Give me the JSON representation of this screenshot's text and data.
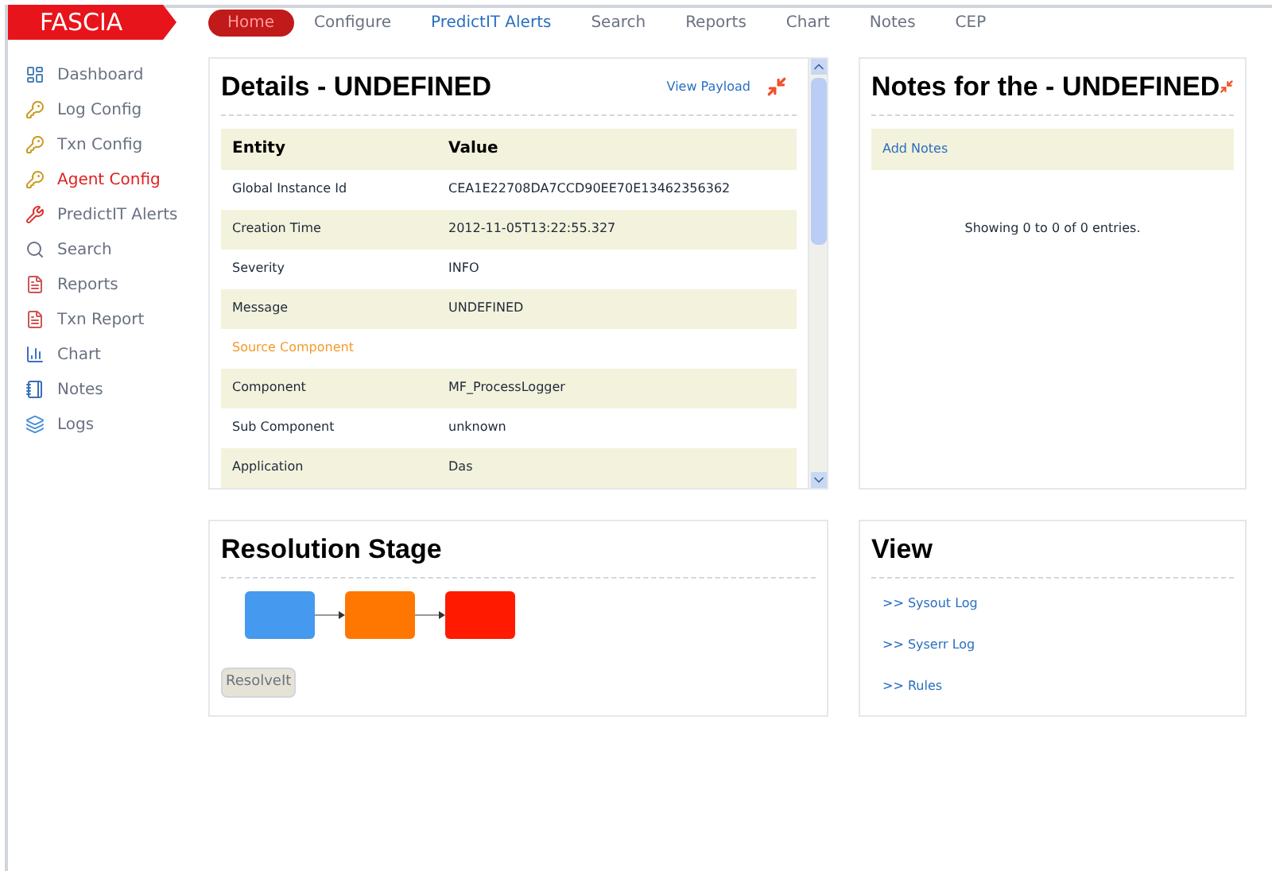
{
  "logo": "FASCIA",
  "nav": [
    {
      "label": "Home",
      "selected": true,
      "highlighted": false
    },
    {
      "label": "Configure",
      "selected": false,
      "highlighted": false
    },
    {
      "label": "PredictIT Alerts",
      "selected": false,
      "highlighted": true
    },
    {
      "label": "Search",
      "selected": false,
      "highlighted": false
    },
    {
      "label": "Reports",
      "selected": false,
      "highlighted": false
    },
    {
      "label": "Chart",
      "selected": false,
      "highlighted": false
    },
    {
      "label": "Notes",
      "selected": false,
      "highlighted": false
    },
    {
      "label": "CEP",
      "selected": false,
      "highlighted": false
    }
  ],
  "sidebar": {
    "items": [
      {
        "label": "Dashboard",
        "kind": "dashboard",
        "selected": false
      },
      {
        "label": "Log Config",
        "kind": "config",
        "selected": false
      },
      {
        "label": "Txn Config",
        "kind": "config",
        "selected": false
      },
      {
        "label": "Agent Config",
        "kind": "config",
        "selected": true
      },
      {
        "label": "PredictIT Alerts",
        "kind": "alerts",
        "selected": false
      },
      {
        "label": "Search",
        "kind": "search",
        "selected": false
      },
      {
        "label": "Reports",
        "kind": "report",
        "selected": false
      },
      {
        "label": "Txn Report",
        "kind": "report",
        "selected": false
      },
      {
        "label": "Chart",
        "kind": "chart",
        "selected": false
      },
      {
        "label": "Notes",
        "kind": "notes",
        "selected": false
      },
      {
        "label": "Logs",
        "kind": "logs",
        "selected": false
      }
    ]
  },
  "details": {
    "title": "Details - UNDEFINED",
    "link": "View Payload",
    "columns": [
      "Entity",
      "Value"
    ],
    "rows": [
      {
        "kind": "field",
        "entity": "Global Instance Id",
        "value": "CEA1E22708DA7CCD90EE70E13462356362"
      },
      {
        "kind": "field",
        "entity": "Creation Time",
        "value": "2012-11-05T13:22:55.327"
      },
      {
        "kind": "field",
        "entity": "Severity",
        "value": "INFO"
      },
      {
        "kind": "field",
        "entity": "Message",
        "value": "UNDEFINED"
      },
      {
        "kind": "section",
        "entity": "Source Component"
      },
      {
        "kind": "field",
        "entity": "Component",
        "value": "MF_ProcessLogger"
      },
      {
        "kind": "field",
        "entity": "Sub Component",
        "value": "unknown"
      },
      {
        "kind": "field",
        "entity": "Application",
        "value": "Das"
      }
    ]
  },
  "notes": {
    "title": "Notes for the - UNDEFINED",
    "link": "Add Notes",
    "info": "Showing 0 to 0 of 0 entries."
  },
  "resolution": {
    "title": "Resolution Stage",
    "stages": [
      {
        "color": "#4599ee"
      },
      {
        "color": "#ff7700"
      },
      {
        "color": "#ff1a00"
      }
    ],
    "button": {
      "label": "ResolveIt",
      "disabled": true
    }
  },
  "view": {
    "title": "View",
    "links": [
      ">> Sysout Log",
      ">> Syserr Log",
      ">> Rules"
    ]
  }
}
